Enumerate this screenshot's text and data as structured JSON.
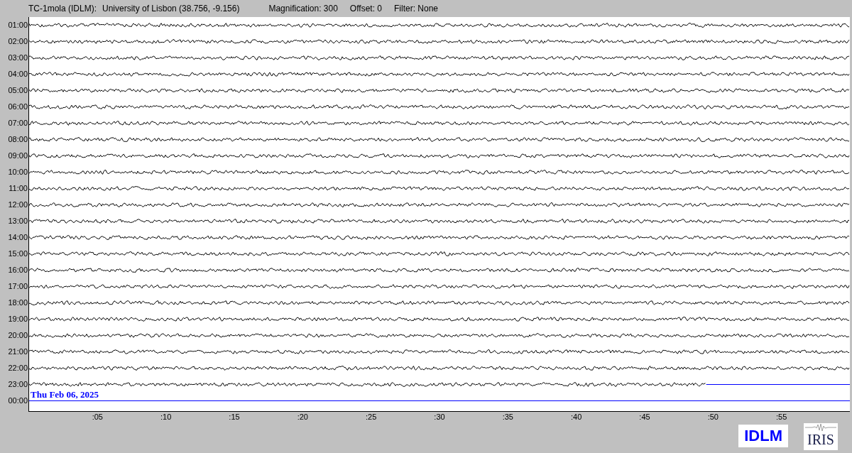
{
  "header": {
    "station": "TC-1mola (IDLM):",
    "location": "University of Lisbon (38.756, -9.156)",
    "magnification": "Magnification: 300",
    "offset": "Offset: 0",
    "filter": "Filter: None"
  },
  "rows": [
    {
      "time": "01:00",
      "kind": "full"
    },
    {
      "time": "02:00",
      "kind": "full"
    },
    {
      "time": "03:00",
      "kind": "full"
    },
    {
      "time": "04:00",
      "kind": "full"
    },
    {
      "time": "05:00",
      "kind": "full"
    },
    {
      "time": "06:00",
      "kind": "full"
    },
    {
      "time": "07:00",
      "kind": "full"
    },
    {
      "time": "08:00",
      "kind": "full"
    },
    {
      "time": "09:00",
      "kind": "full"
    },
    {
      "time": "10:00",
      "kind": "full"
    },
    {
      "time": "11:00",
      "kind": "full"
    },
    {
      "time": "12:00",
      "kind": "full"
    },
    {
      "time": "13:00",
      "kind": "full"
    },
    {
      "time": "14:00",
      "kind": "full"
    },
    {
      "time": "15:00",
      "kind": "full"
    },
    {
      "time": "16:00",
      "kind": "full"
    },
    {
      "time": "17:00",
      "kind": "full"
    },
    {
      "time": "18:00",
      "kind": "full"
    },
    {
      "time": "19:00",
      "kind": "full"
    },
    {
      "time": "20:00",
      "kind": "full"
    },
    {
      "time": "21:00",
      "kind": "full"
    },
    {
      "time": "22:00",
      "kind": "full"
    },
    {
      "time": "23:00",
      "kind": "partial"
    },
    {
      "time": "00:00",
      "kind": "empty"
    }
  ],
  "date_label": "Thu Feb 06, 2025",
  "x_axis": {
    "ticks": [
      ":05",
      ":10",
      ":15",
      ":20",
      ":25",
      ":30",
      ":35",
      ":40",
      ":45",
      ":50",
      ":55"
    ]
  },
  "logos": {
    "station": "IDLM",
    "network": "IRIS"
  }
}
